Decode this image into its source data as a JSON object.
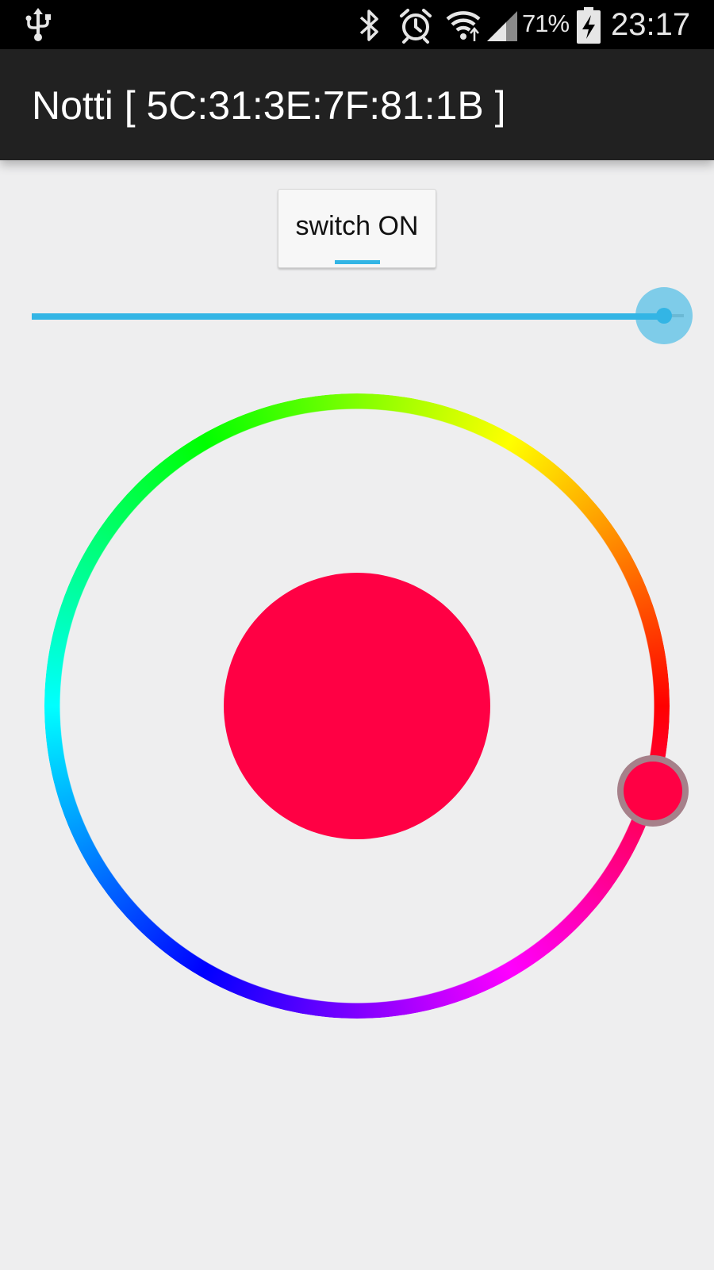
{
  "status_bar": {
    "icons": [
      "usb-icon",
      "bluetooth-icon",
      "alarm-icon",
      "wifi-icon",
      "signal-icon",
      "battery-charging-icon"
    ],
    "battery_percent": "71%",
    "time": "23:17"
  },
  "action_bar": {
    "title": "Notti [ 5C:31:3E:7F:81:1B ]"
  },
  "toggle": {
    "label": "switch ON",
    "checked": true
  },
  "brightness_slider": {
    "value": 0.97
  },
  "color_picker": {
    "selected_color": "#ff0044",
    "ring_colors": [
      "#ff0000",
      "#ff00ff",
      "#0000ff",
      "#00ffff",
      "#00ff00",
      "#ffff00"
    ]
  },
  "colors": {
    "accent": "#33b5e5",
    "action_bar_bg": "#212121",
    "background": "#eeeeef"
  }
}
